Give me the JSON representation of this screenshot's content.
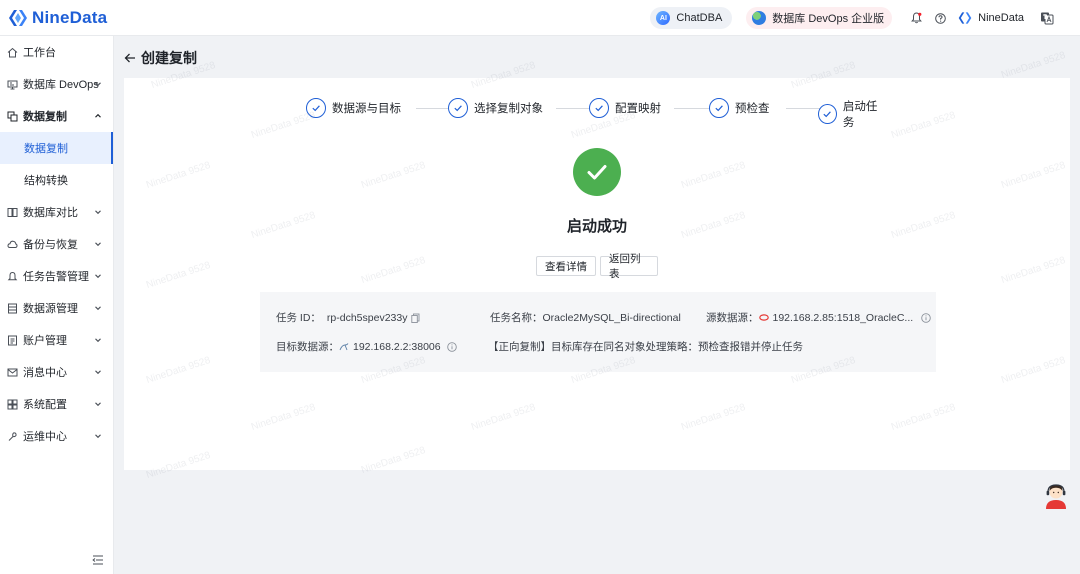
{
  "header": {
    "brand": "NineData",
    "chatdba_label": "ChatDBA",
    "chatdba_badge": "AI",
    "edition_label": "数据库 DevOps 企业版",
    "user_name": "NineData"
  },
  "sidebar": {
    "items": [
      {
        "label": "工作台",
        "icon": "home-icon"
      },
      {
        "label": "数据库 DevOps",
        "icon": "devops-icon"
      },
      {
        "label": "数据复制",
        "icon": "replication-icon"
      },
      {
        "label": "数据复制"
      },
      {
        "label": "结构转换"
      },
      {
        "label": "数据库对比",
        "icon": "compare-icon"
      },
      {
        "label": "备份与恢复",
        "icon": "backup-icon"
      },
      {
        "label": "任务告警管理",
        "icon": "alarm-icon"
      },
      {
        "label": "数据源管理",
        "icon": "datasource-icon"
      },
      {
        "label": "账户管理",
        "icon": "account-icon"
      },
      {
        "label": "消息中心",
        "icon": "message-icon"
      },
      {
        "label": "系统配置",
        "icon": "config-icon"
      },
      {
        "label": "运维中心",
        "icon": "ops-icon"
      }
    ]
  },
  "page": {
    "title": "创建复制"
  },
  "steps": [
    {
      "label": "数据源与目标"
    },
    {
      "label": "选择复制对象"
    },
    {
      "label": "配置映射"
    },
    {
      "label": "预检查"
    },
    {
      "label": "启动任务"
    }
  ],
  "result": {
    "title": "启动成功",
    "view_details": "查看详情",
    "back_to_list": "返回列表"
  },
  "info": {
    "task_id_label": "任务 ID：",
    "task_id": "rp-dch5spev233y",
    "task_name_label": "任务名称：",
    "task_name": "Oracle2MySQL_Bi-directional",
    "source_label": "源数据源：",
    "source": "192.168.2.85:1518_OracleC...",
    "target_label": "目标数据源：",
    "target": "192.168.2.2:38006",
    "strategy": "【正向复制】目标库存在同名对象处理策略：预检查报错并停止任务"
  },
  "watermark": "NineData 9528",
  "colors": {
    "accent": "#1f5fd6",
    "success": "#4caf50"
  }
}
